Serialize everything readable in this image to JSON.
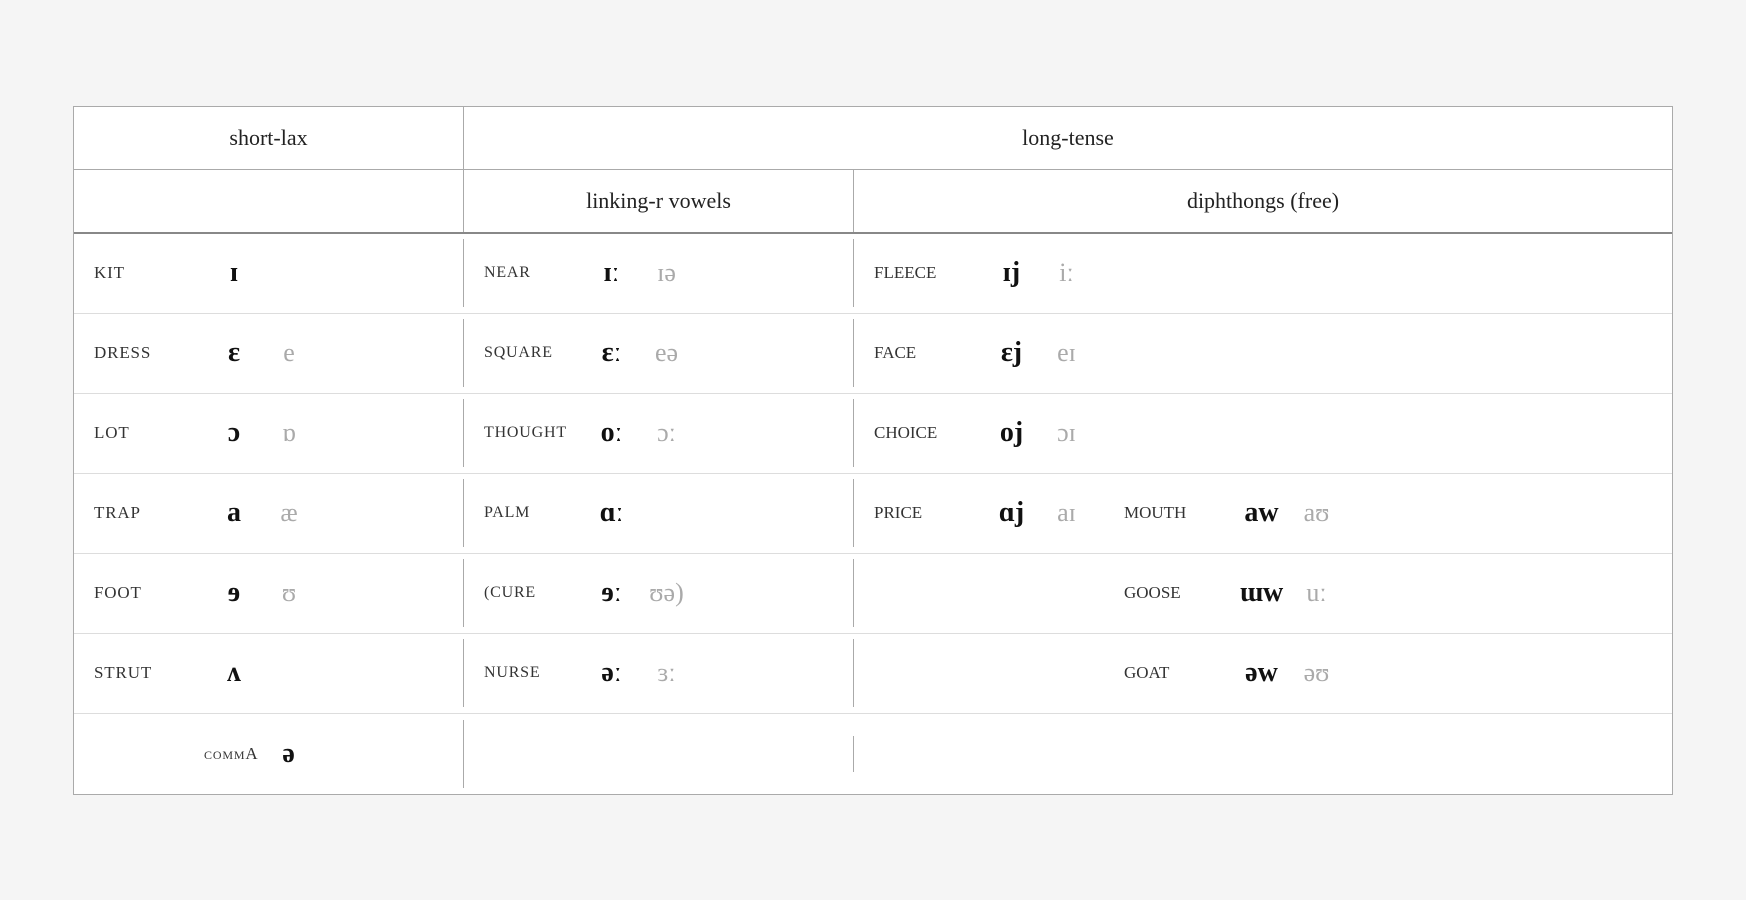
{
  "headers": {
    "short_lax": "short-lax",
    "long_tense": "long-tense",
    "linking_r": "linking-r vowels",
    "diphthongs": "diphthongs (free)"
  },
  "rows": [
    {
      "short_lax": {
        "keyword": "KIT",
        "primary": "ɪ",
        "secondary": ""
      },
      "linking_r": {
        "keyword": "NEAR",
        "primary": "ɪː",
        "secondary": "ɪə"
      },
      "diphthongs_left": {
        "keyword": "FLEECE",
        "primary": "ɪj",
        "secondary": "iː"
      },
      "diphthongs_right": {
        "keyword": "",
        "primary": "",
        "secondary": ""
      }
    },
    {
      "short_lax": {
        "keyword": "DRESS",
        "primary": "ɛ",
        "secondary": "e"
      },
      "linking_r": {
        "keyword": "SQUARE",
        "primary": "ɛː",
        "secondary": "eə"
      },
      "diphthongs_left": {
        "keyword": "FACE",
        "primary": "ɛj",
        "secondary": "eɪ"
      },
      "diphthongs_right": {
        "keyword": "",
        "primary": "",
        "secondary": ""
      }
    },
    {
      "short_lax": {
        "keyword": "LOT",
        "primary": "ɔ",
        "secondary": "ɒ"
      },
      "linking_r": {
        "keyword": "THOUGHT",
        "primary": "oː",
        "secondary": "ɔː"
      },
      "diphthongs_left": {
        "keyword": "CHOICE",
        "primary": "oj",
        "secondary": "ɔɪ"
      },
      "diphthongs_right": {
        "keyword": "",
        "primary": "",
        "secondary": ""
      }
    },
    {
      "short_lax": {
        "keyword": "TRAP",
        "primary": "a",
        "secondary": "æ"
      },
      "linking_r": {
        "keyword": "PALM",
        "primary": "ɑː",
        "secondary": ""
      },
      "diphthongs_left": {
        "keyword": "PRICE",
        "primary": "ɑj",
        "secondary": "aɪ"
      },
      "diphthongs_right": {
        "keyword": "MOUTH",
        "primary": "aw",
        "secondary": "aʊ"
      }
    },
    {
      "short_lax": {
        "keyword": "FOOT",
        "primary": "ɘ",
        "secondary": "ʊ"
      },
      "linking_r": {
        "keyword": "(CURE",
        "primary": "ɘː",
        "secondary": "ʊə)"
      },
      "diphthongs_left": {
        "keyword": "",
        "primary": "",
        "secondary": ""
      },
      "diphthongs_right": {
        "keyword": "GOOSE",
        "primary": "ɯw",
        "secondary": "uː"
      }
    },
    {
      "short_lax": {
        "keyword": "STRUT",
        "primary": "ʌ",
        "secondary": ""
      },
      "linking_r": {
        "keyword": "NURSE",
        "primary": "əː",
        "secondary": "ɜː"
      },
      "diphthongs_left": {
        "keyword": "",
        "primary": "",
        "secondary": ""
      },
      "diphthongs_right": {
        "keyword": "GOAT",
        "primary": "əw",
        "secondary": "əʊ"
      }
    },
    {
      "short_lax": {
        "keyword": "commA",
        "primary": "ə",
        "secondary": ""
      },
      "linking_r": {
        "keyword": "",
        "primary": "",
        "secondary": ""
      },
      "diphthongs_left": {
        "keyword": "",
        "primary": "",
        "secondary": ""
      },
      "diphthongs_right": {
        "keyword": "",
        "primary": "",
        "secondary": ""
      }
    }
  ]
}
